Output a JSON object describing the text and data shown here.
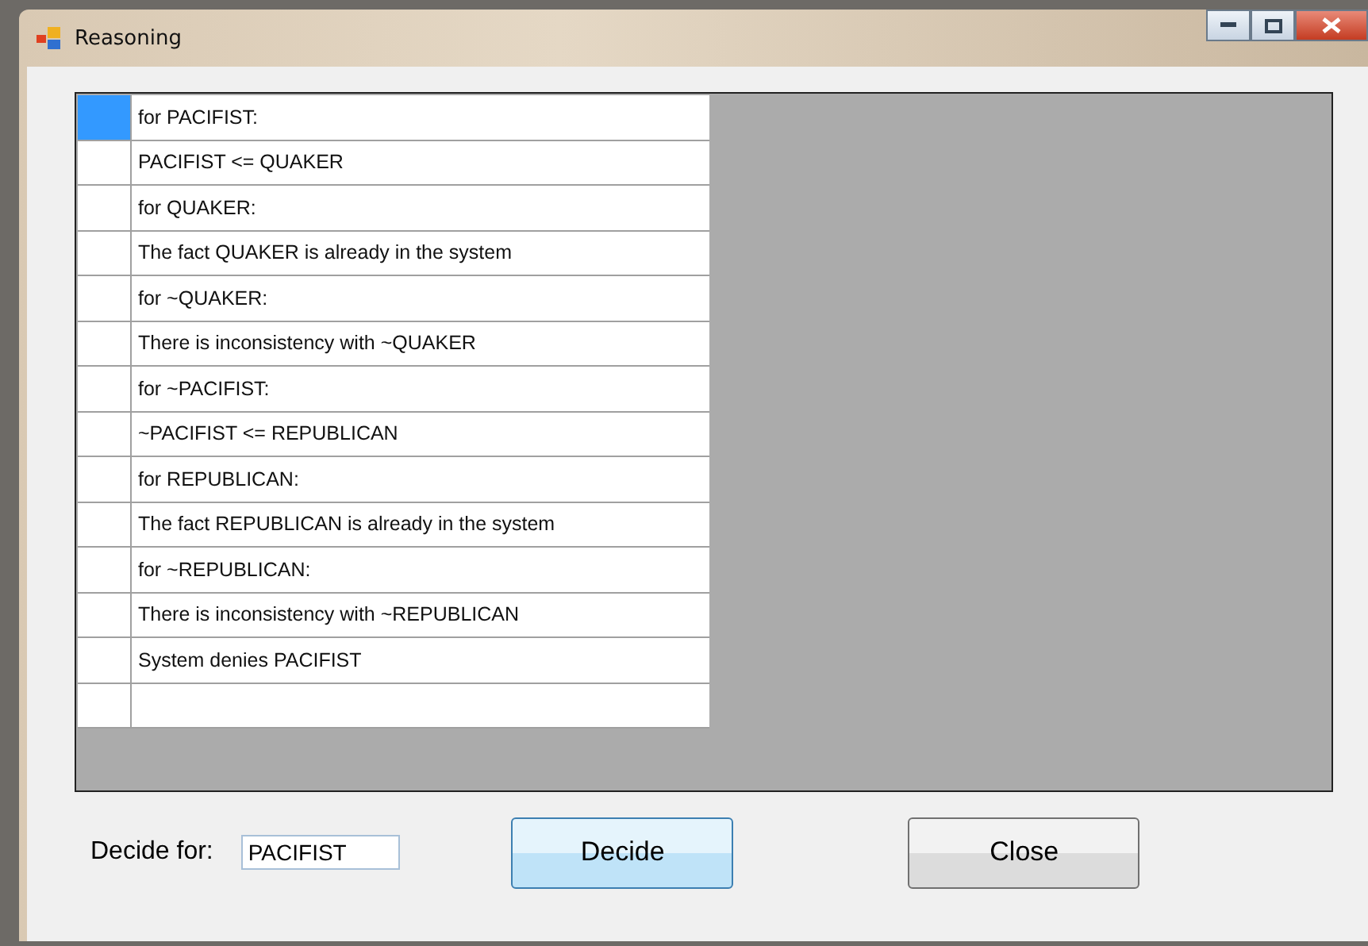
{
  "window": {
    "title": "Reasoning"
  },
  "grid": {
    "rows": [
      {
        "text": "for PACIFIST:",
        "selected": true
      },
      {
        "text": "PACIFIST <= QUAKER",
        "selected": false
      },
      {
        "text": "for QUAKER:",
        "selected": false
      },
      {
        "text": "The fact QUAKER is already in the system",
        "selected": false
      },
      {
        "text": "for ~QUAKER:",
        "selected": false
      },
      {
        "text": "There is inconsistency with ~QUAKER",
        "selected": false
      },
      {
        "text": "for ~PACIFIST:",
        "selected": false
      },
      {
        "text": "~PACIFIST <= REPUBLICAN",
        "selected": false
      },
      {
        "text": "for REPUBLICAN:",
        "selected": false
      },
      {
        "text": "The fact REPUBLICAN is already in the system",
        "selected": false
      },
      {
        "text": "for ~REPUBLICAN:",
        "selected": false
      },
      {
        "text": "There is inconsistency with ~REPUBLICAN",
        "selected": false
      },
      {
        "text": "System denies PACIFIST",
        "selected": false
      }
    ]
  },
  "decide_for": {
    "label": "Decide for:",
    "value": "PACIFIST"
  },
  "buttons": [
    {
      "label": "Decide",
      "kind": "default"
    },
    {
      "label": "Close",
      "kind": "normal"
    }
  ]
}
